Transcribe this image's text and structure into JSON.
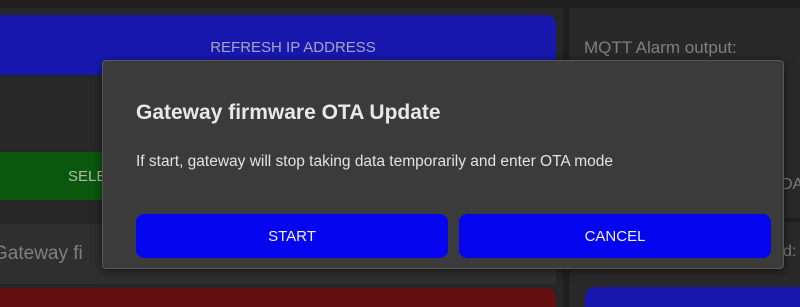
{
  "background": {
    "refresh_label": "REFRESH IP ADDRESS",
    "select_fragment": "SELE",
    "gateway_fragment": "Gateway fi",
    "mqtt_label": "MQTT Alarm output:",
    "right_fragment_a": "DA",
    "right_fragment_b": "d:"
  },
  "dialog": {
    "title": "Gateway firmware OTA Update",
    "message": "If start, gateway will stop taking data temporarily and enter OTA mode",
    "start_label": "START",
    "cancel_label": "CANCEL"
  },
  "colors": {
    "accent_blue": "#0505f0",
    "dialog_bg": "#3b3b3b",
    "success_green": "#0d6b12",
    "danger_red": "#7a1414"
  }
}
